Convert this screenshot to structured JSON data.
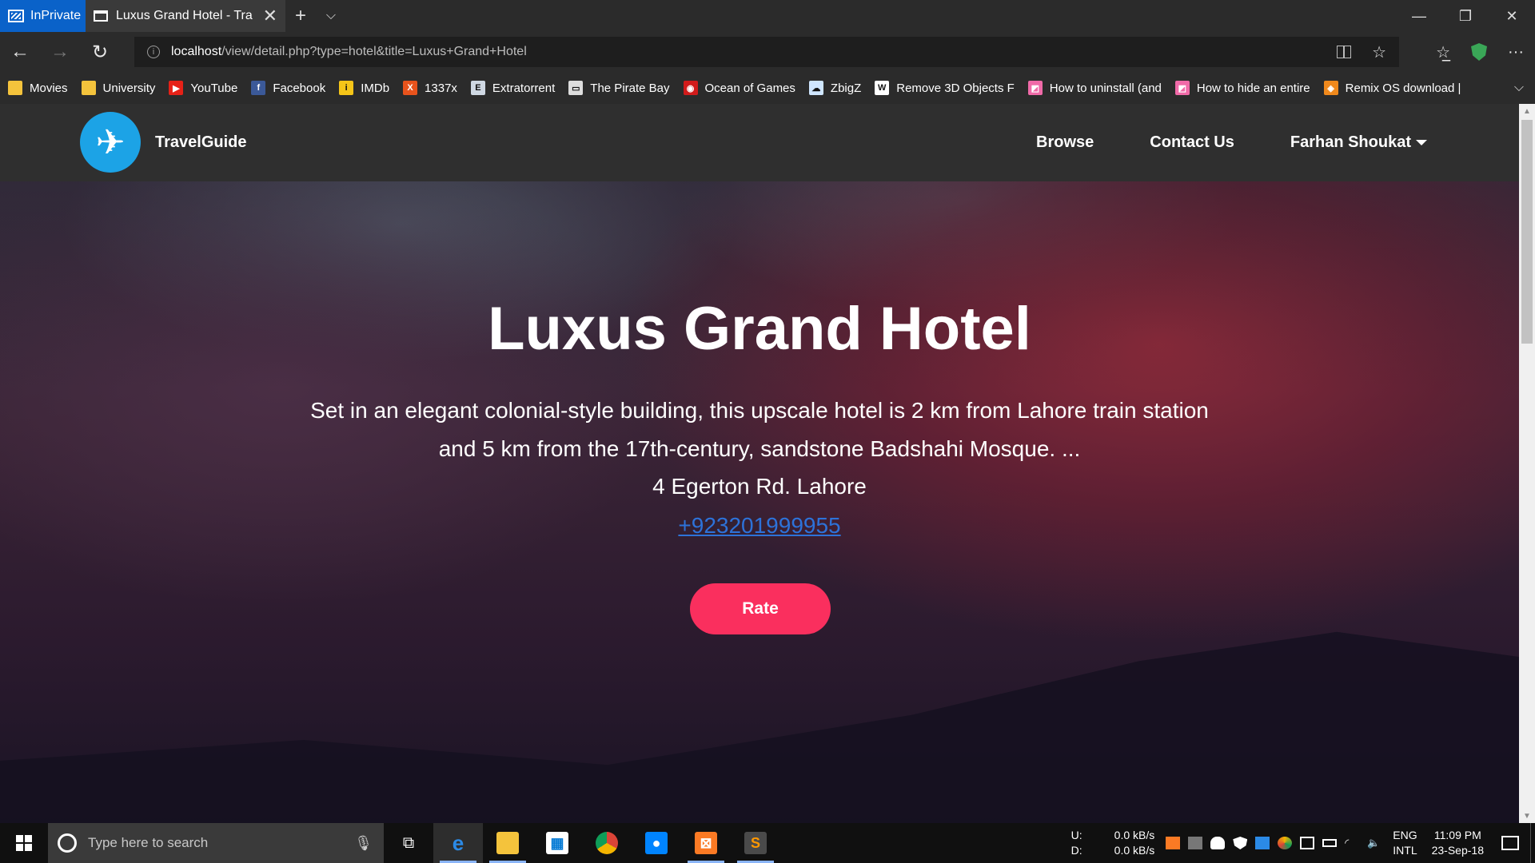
{
  "browser": {
    "inprivate_label": "InPrivate",
    "tab_title": "Luxus Grand Hotel - Tra",
    "url_host": "localhost",
    "url_path": "/view/detail.php?type=hotel&title=Luxus+Grand+Hotel",
    "favorites": [
      {
        "label": "Movies",
        "icon": "folder-icon",
        "color": "#f4c33c"
      },
      {
        "label": "University",
        "icon": "folder-icon",
        "color": "#f4c33c"
      },
      {
        "label": "YouTube",
        "icon": "youtube-icon",
        "color": "#e62117"
      },
      {
        "label": "Facebook",
        "icon": "facebook-icon",
        "color": "#3b5998"
      },
      {
        "label": "IMDb",
        "icon": "imdb-icon",
        "color": "#f5c518"
      },
      {
        "label": "1337x",
        "icon": "1337x-icon",
        "color": "#e8531c"
      },
      {
        "label": "Extratorrent",
        "icon": "extratorrent-icon",
        "color": "#cfd8e3"
      },
      {
        "label": "The Pirate Bay",
        "icon": "piratebay-icon",
        "color": "#dddddd"
      },
      {
        "label": "Ocean of Games",
        "icon": "ocean-of-games-icon",
        "color": "#d11b1b"
      },
      {
        "label": "ZbigZ",
        "icon": "cloud-icon",
        "color": "#cfe6ff"
      },
      {
        "label": "Remove 3D Objects F",
        "icon": "wikipedia-icon",
        "color": "#ffffff"
      },
      {
        "label": "How to uninstall (and",
        "icon": "pink-page-icon",
        "color": "#f06aa8"
      },
      {
        "label": "How to hide an entire",
        "icon": "pink-page-icon",
        "color": "#f06aa8"
      },
      {
        "label": "Remix OS download |",
        "icon": "remix-icon",
        "color": "#f0891c"
      }
    ]
  },
  "site": {
    "brand": "TravelGuide",
    "nav": {
      "browse": "Browse",
      "contact": "Contact Us",
      "user": "Farhan Shoukat"
    }
  },
  "hotel": {
    "title": "Luxus Grand Hotel",
    "description": "Set in an elegant colonial-style building, this upscale hotel is 2 km from Lahore train station and 5 km from the 17th-century, sandstone Badshahi Mosque. ...",
    "address": "4 Egerton Rd. Lahore",
    "phone": "+923201999955",
    "rate_label": "Rate"
  },
  "colors": {
    "rate_button": "#fa2f5e",
    "brand_logo": "#1ca3e6",
    "phone_link": "#2d72d9"
  },
  "taskbar": {
    "search_placeholder": "Type here to search",
    "net_up_label": "U:",
    "net_down_label": "D:",
    "net_up_value": "0.0 kB/s",
    "net_down_value": "0.0 kB/s",
    "lang_1": "ENG",
    "lang_2": "INTL",
    "time": "11:09 PM",
    "date": "23-Sep-18"
  }
}
